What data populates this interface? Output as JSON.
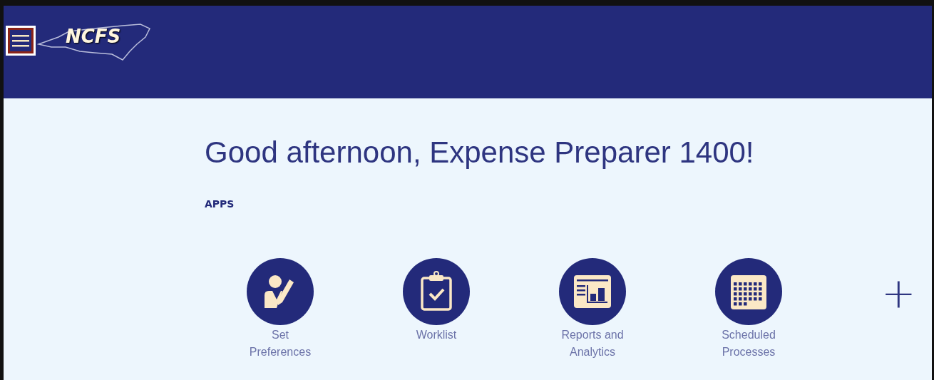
{
  "header": {
    "logo_text": "NCFS"
  },
  "greeting": "Good afternoon, Expense Preparer 1400!",
  "section_title": "APPS",
  "apps": [
    {
      "kind": "preferences",
      "label": "Set Preferences"
    },
    {
      "kind": "worklist",
      "label": "Worklist"
    },
    {
      "kind": "reports",
      "label": "Reports and Analytics"
    },
    {
      "kind": "calendar",
      "label": "Scheduled Processes"
    }
  ],
  "add_button": "+"
}
